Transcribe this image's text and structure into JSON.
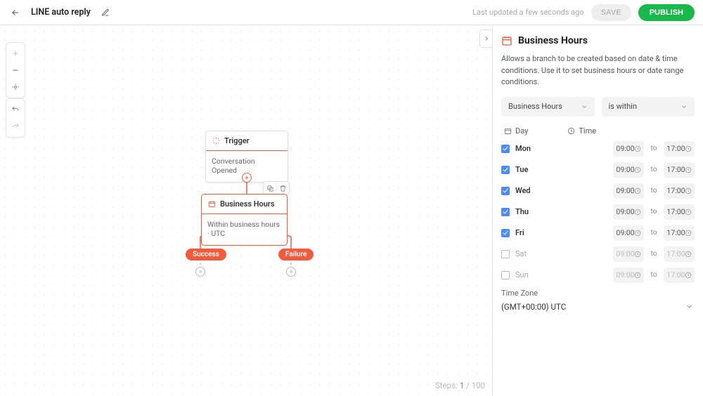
{
  "header": {
    "title": "LINE auto reply",
    "last_updated": "Last updated a few seconds ago",
    "save_label": "SAVE",
    "publish_label": "PUBLISH"
  },
  "canvas": {
    "trigger": {
      "title": "Trigger",
      "body": "Conversation Opened"
    },
    "business_hours": {
      "title": "Business Hours",
      "body": "Within business hours · UTC"
    },
    "branches": {
      "left": "Success",
      "right": "Failure"
    },
    "steps": {
      "label": "Steps:",
      "current": "1",
      "total": "100"
    }
  },
  "panel": {
    "title": "Business Hours",
    "description": "Allows a branch to be created based on date & time conditions. Use it to set business hours or date range conditions.",
    "selector_type": "Business Hours",
    "selector_condition": "is within",
    "day_label": "Day",
    "time_label": "Time",
    "to_label": "to",
    "timezone_label": "Time Zone",
    "timezone_value": "(GMT+00:00) UTC",
    "days": [
      {
        "name": "Mon",
        "checked": true,
        "start": "09:00",
        "end": "17:00"
      },
      {
        "name": "Tue",
        "checked": true,
        "start": "09:00",
        "end": "17:00"
      },
      {
        "name": "Wed",
        "checked": true,
        "start": "09:00",
        "end": "17:00"
      },
      {
        "name": "Thu",
        "checked": true,
        "start": "09:00",
        "end": "17:00"
      },
      {
        "name": "Fri",
        "checked": true,
        "start": "09:00",
        "end": "17:00"
      },
      {
        "name": "Sat",
        "checked": false,
        "start": "09:00",
        "end": "17:00"
      },
      {
        "name": "Sun",
        "checked": false,
        "start": "09:00",
        "end": "17:00"
      }
    ]
  }
}
